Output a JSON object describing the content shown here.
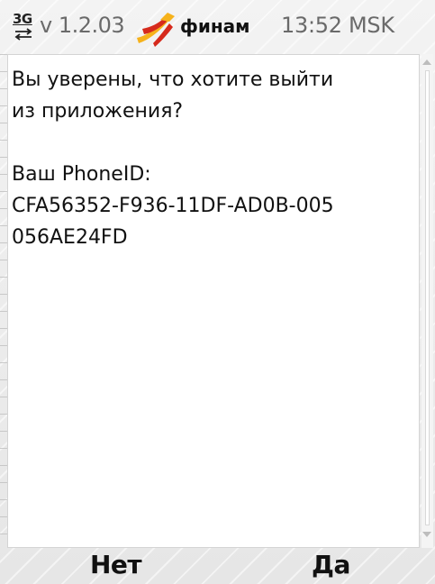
{
  "statusbar": {
    "network_label": "3G",
    "network_icon": "data-transfer-arrows-icon",
    "version": "v 1.2.03",
    "logo_icon": "finam-logo-icon",
    "brand": "финам",
    "time": "13:52 MSK"
  },
  "dialog": {
    "lines": [
      "Вы уверены, что хотите выйти",
      "из приложения?",
      "",
      "Ваш PhoneID:",
      "CFA56352-F936-11DF-AD0B-005",
      "056AE24FD"
    ]
  },
  "softkeys": {
    "left": "Нет",
    "right": "Да"
  },
  "colors": {
    "brand_red": "#d62a1c",
    "brand_yellow": "#f6b21b"
  }
}
